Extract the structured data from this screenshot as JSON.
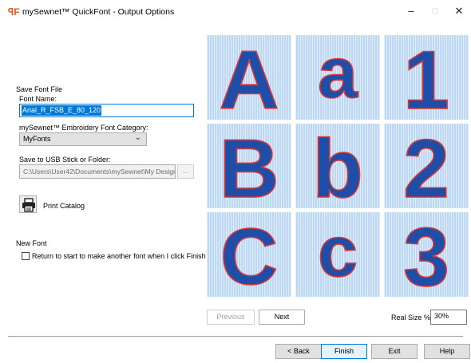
{
  "window": {
    "title": "mySewnet™ QuickFont - Output Options",
    "app_icon": "qf-app-icon",
    "minimize": "–",
    "maximize": "□",
    "close": "✕"
  },
  "save_font_file": {
    "section_label": "Save Font File",
    "font_name_label": "Font Name:",
    "font_name_value": "Arial_R_FSB_E_80_120",
    "category_label": "mySewnet™ Embroidery Font Category:",
    "category_value": "MyFonts",
    "folder_label": "Save to USB Stick or Folder:",
    "folder_value": "C:\\Users\\User42\\Documents\\mySewnet\\My Design",
    "browse_label": "...",
    "print_catalog_label": "Print Catalog"
  },
  "new_font": {
    "section_label": "New Font",
    "checkbox_label": "Return to start to make another font when I click Finish",
    "checked": false
  },
  "preview": {
    "glyphs": [
      "A",
      "a",
      "1",
      "B",
      "b",
      "2",
      "C",
      "c",
      "3"
    ],
    "fill_color": "#1f4ea8",
    "outline_color": "#d93838",
    "background_color": "#bcd8f4",
    "previous_label": "Previous",
    "next_label": "Next",
    "real_size_label": "Real Size %",
    "real_size_value": "30%"
  },
  "footer": {
    "back_label": "< Back",
    "finish_label": "Finish",
    "exit_label": "Exit",
    "help_label": "Help"
  }
}
